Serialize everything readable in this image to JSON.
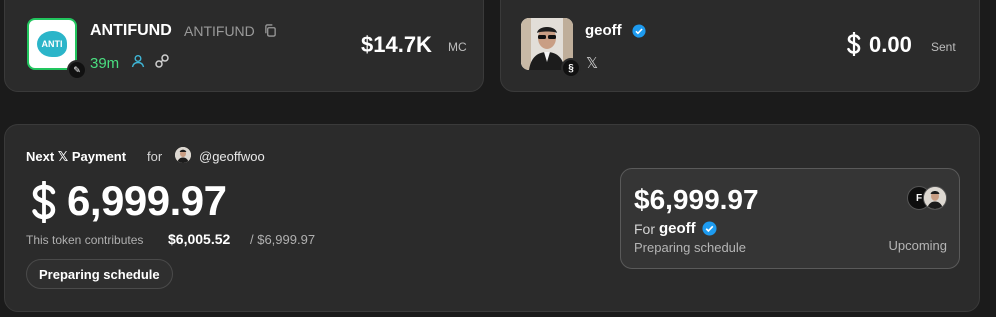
{
  "token": {
    "name": "ANTIFUND",
    "ticker": "ANTIFUND",
    "age": "39m",
    "market_cap": "$14.7K",
    "market_cap_label": "MC",
    "logo_text": "ANTI"
  },
  "creator": {
    "name": "geoff",
    "sent_value": "0.00",
    "sent_label": "Sent",
    "social_icon": "x-icon"
  },
  "payment": {
    "title": "Next 𝕏 Payment",
    "for_word": "for",
    "handle": "@geoffwoo",
    "amount": "6,999.97",
    "contrib_label": "This token contributes",
    "contrib_value": "$6,005.52",
    "contrib_total": "/ $6,999.97",
    "status_pill": "Preparing schedule"
  },
  "schedule": {
    "amount": "$6,999.97",
    "for_word": "For",
    "recipient": "geoff",
    "status": "Preparing schedule",
    "state": "Upcoming"
  },
  "colors": {
    "accent_green": "#4ade80",
    "verified_blue": "#1d9bf0",
    "card_bg": "#2b2b2b"
  }
}
